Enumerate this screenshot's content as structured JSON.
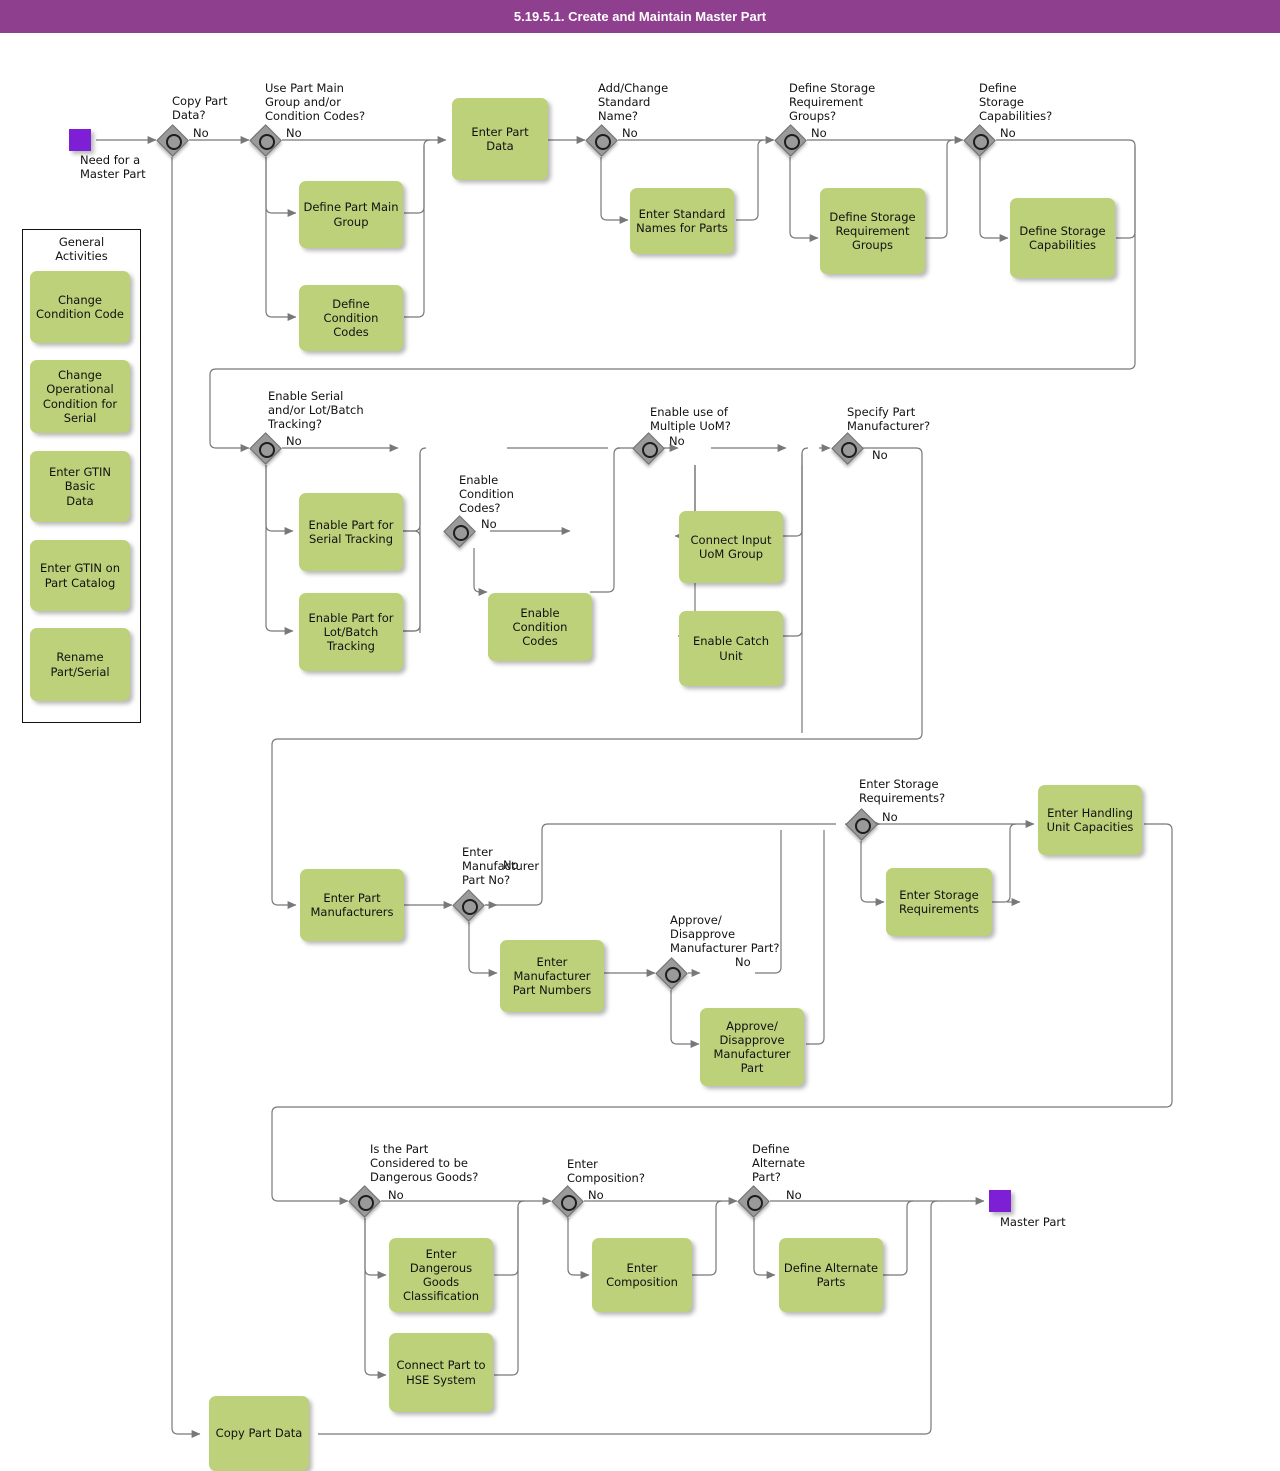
{
  "header": {
    "title": "5.19.5.1. Create and Maintain Master Part"
  },
  "colors": {
    "header_bar": "#8e3f8e",
    "task_fill": "#bdd17a",
    "event_fill": "#7d1fd4",
    "gateway_fill": "#9a9a9a",
    "line": "#777777"
  },
  "labels": {
    "no": "No"
  },
  "events": {
    "start": {
      "label": "Need for a\nMaster Part",
      "line1": "Need for a",
      "line2": "Master Part"
    },
    "end": {
      "label": "Master Part"
    }
  },
  "panel": {
    "title_line1": "General",
    "title_line2": "Activities",
    "items": [
      {
        "label": "Change\nCondition Code",
        "l1": "Change",
        "l2": "Condition Code"
      },
      {
        "label": "Change\nOperational\nCondition for\nSerial",
        "l1": "Change",
        "l2": "Operational",
        "l3": "Condition for",
        "l4": "Serial"
      },
      {
        "label": "Enter GTIN Basic\nData",
        "l1": "Enter GTIN Basic",
        "l2": "Data"
      },
      {
        "label": "Enter GTIN on\nPart Catalog",
        "l1": "Enter GTIN on",
        "l2": "Part Catalog"
      },
      {
        "label": "Rename\nPart/Serial",
        "l1": "Rename",
        "l2": "Part/Serial"
      }
    ]
  },
  "gateways": [
    {
      "id": "g_copy_part_data",
      "question": "Copy Part\nData?",
      "q1": "Copy Part",
      "q2": "Data?",
      "no": "No"
    },
    {
      "id": "g_use_part_main_group",
      "question": "Use Part Main\nGroup and/or\nCondition Codes?",
      "q1": "Use Part Main",
      "q2": "Group and/or",
      "q3": "Condition Codes?",
      "no": "No"
    },
    {
      "id": "g_add_change_standard_name",
      "question": "Add/Change\nStandard\nName?",
      "q1": "Add/Change",
      "q2": "Standard",
      "q3": "Name?",
      "no": "No"
    },
    {
      "id": "g_define_storage_requirement_groups",
      "question": "Define Storage\nRequirement\nGroups?",
      "q1": "Define Storage",
      "q2": "Requirement",
      "q3": "Groups?",
      "no": "No"
    },
    {
      "id": "g_define_storage_capabilities",
      "question": "Define\nStorage\nCapabilities?",
      "q1": "Define",
      "q2": "Storage",
      "q3": "Capabilities?",
      "no": "No"
    },
    {
      "id": "g_enable_serial_lot_batch_tracking",
      "question": "Enable Serial\nand/or Lot/Batch\nTracking?",
      "q1": "Enable Serial",
      "q2": "and/or Lot/Batch",
      "q3": "Tracking?",
      "no": "No"
    },
    {
      "id": "g_enable_condition_codes",
      "question": "Enable\nCondition\nCodes?",
      "q1": "Enable",
      "q2": "Condition",
      "q3": "Codes?",
      "no": "No"
    },
    {
      "id": "g_enable_multiple_uom",
      "question": "Enable use of\nMultiple UoM?",
      "q1": "Enable use of",
      "q2": "Multiple UoM?",
      "no": "No"
    },
    {
      "id": "g_specify_part_manufacturer",
      "question": "Specify Part\nManufacturer?",
      "q1": "Specify Part",
      "q2": "Manufacturer?",
      "no": "No"
    },
    {
      "id": "g_enter_manufacturer_part_no",
      "question": "Enter\nManufacturer\nPart No?",
      "q1": "Enter",
      "q2": "Manufacturer",
      "q3": "Part No?",
      "no": "No"
    },
    {
      "id": "g_approve_disapprove_manufacturer_part",
      "question": "Approve/\nDisapprove\nManufacturer Part?",
      "q1": "Approve/",
      "q2": "Disapprove",
      "q3": "Manufacturer Part?",
      "no": "No"
    },
    {
      "id": "g_enter_storage_requirements",
      "question": "Enter Storage\nRequirements?",
      "q1": "Enter Storage",
      "q2": "Requirements?",
      "no": "No"
    },
    {
      "id": "g_dangerous_goods",
      "question": "Is the Part\nConsidered to be\nDangerous Goods?",
      "q1": "Is the Part",
      "q2": "Considered to be",
      "q3": "Dangerous Goods?",
      "no": "No"
    },
    {
      "id": "g_enter_composition",
      "question": "Enter\nComposition?",
      "q1": "Enter",
      "q2": "Composition?",
      "no": "No"
    },
    {
      "id": "g_define_alternate_part",
      "question": "Define\nAlternate\nPart?",
      "q1": "Define",
      "q2": "Alternate",
      "q3": "Part?",
      "no": "No"
    }
  ],
  "tasks": [
    {
      "id": "t_enter_part_data",
      "label": "Enter Part Data"
    },
    {
      "id": "t_define_part_main_group",
      "label": "Define Part Main\nGroup"
    },
    {
      "id": "t_define_condition_codes",
      "label": "Define Condition\nCodes"
    },
    {
      "id": "t_enter_standard_names_for_parts",
      "label": "Enter Standard\nNames for Parts"
    },
    {
      "id": "t_define_storage_requirement_groups",
      "label": "Define Storage\nRequirement\nGroups"
    },
    {
      "id": "t_define_storage_capabilities",
      "label": "Define Storage\nCapabilities"
    },
    {
      "id": "t_enable_part_for_serial_tracking",
      "label": "Enable Part for\nSerial Tracking"
    },
    {
      "id": "t_enable_part_for_lot_batch_tracking",
      "label": "Enable Part for\nLot/Batch\nTracking"
    },
    {
      "id": "t_enable_condition_codes",
      "label": "Enable Condition\nCodes"
    },
    {
      "id": "t_connect_input_uom_group",
      "label": "Connect Input\nUoM Group"
    },
    {
      "id": "t_enable_catch_unit",
      "label": "Enable Catch\nUnit"
    },
    {
      "id": "t_enter_part_manufacturers",
      "label": "Enter Part\nManufacturers"
    },
    {
      "id": "t_enter_manufacturer_part_numbers",
      "label": "Enter\nManufacturer\nPart Numbers"
    },
    {
      "id": "t_approve_disapprove_manufacturer_part",
      "label": "Approve/\nDisapprove\nManufacturer\nPart"
    },
    {
      "id": "t_enter_storage_requirements",
      "label": "Enter Storage\nRequirements"
    },
    {
      "id": "t_enter_handling_unit_capacities",
      "label": "Enter Handling\nUnit Capacities"
    },
    {
      "id": "t_enter_dangerous_goods_classification",
      "label": "Enter Dangerous\nGoods\nClassification"
    },
    {
      "id": "t_connect_part_to_hse_system",
      "label": "Connect Part to\nHSE System"
    },
    {
      "id": "t_enter_composition",
      "label": "Enter\nComposition"
    },
    {
      "id": "t_define_alternate_parts",
      "label": "Define Alternate\nParts"
    },
    {
      "id": "t_copy_part_data",
      "label": "Copy Part Data"
    }
  ]
}
